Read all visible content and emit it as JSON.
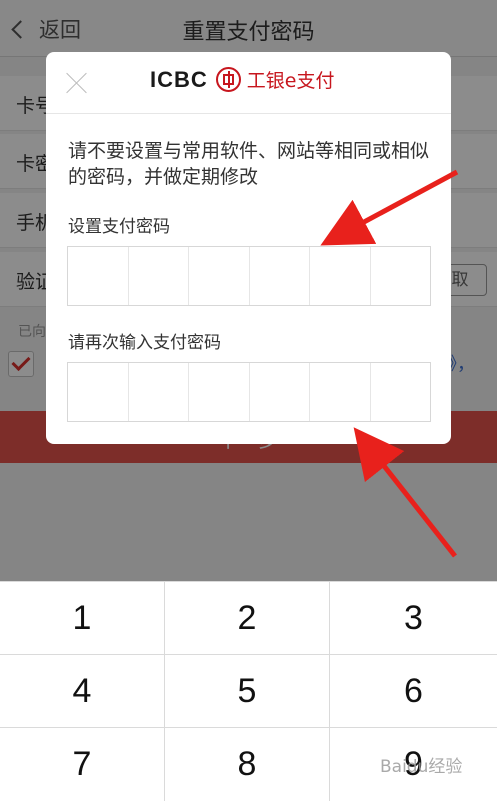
{
  "navbar": {
    "back_label": "返回",
    "title": "重置支付密码"
  },
  "background_form": {
    "rows": [
      {
        "label": "卡号"
      },
      {
        "label": "卡密"
      },
      {
        "label": "手机"
      },
      {
        "label": "验证"
      }
    ],
    "get_code_label": "取",
    "hint": "已向",
    "agree_link": "》，",
    "submit_label": "下一步"
  },
  "dialog": {
    "brand_text": "ICBC",
    "brand_zh": "工银e支付",
    "warning": "请不要设置与常用软件、网站等相同或相似的密码，并做定期修改",
    "set_label": "设置支付密码",
    "confirm_label": "请再次输入支付密码",
    "digits_per_field": 6
  },
  "keypad": {
    "keys": [
      "1",
      "2",
      "3",
      "4",
      "5",
      "6",
      "7",
      "8",
      "9"
    ]
  },
  "watermark": "Baidu经验",
  "colors": {
    "brand_red": "#c7161e",
    "submit_red": "#e3534c",
    "arrow_red": "#e8211c"
  },
  "icons": [
    "chevron-left-icon",
    "close-icon",
    "icbc-logo-icon",
    "checkmark-icon",
    "arrow-icon"
  ]
}
